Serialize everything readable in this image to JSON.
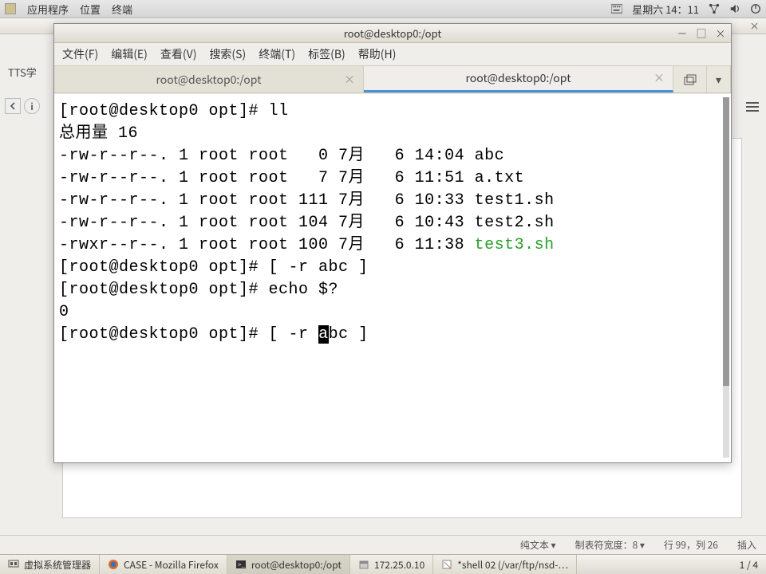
{
  "topbar": {
    "app": "应用程序",
    "places": "位置",
    "terminal_menu": "终端",
    "datetime": "星期六 14：11"
  },
  "gedit": {
    "tab_label": "TTS学",
    "status": {
      "encoding": "纯文本 ▾",
      "tabwidth": "制表符宽度：8 ▾",
      "rowcol": "行 99，列 26",
      "insert": "插入"
    },
    "close": "×"
  },
  "terminal": {
    "title": "root@desktop0:/opt",
    "menus": [
      "文件(F)",
      "编辑(E)",
      "查看(V)",
      "搜索(S)",
      "终端(T)",
      "标签(B)",
      "帮助(H)"
    ],
    "tabs": [
      {
        "label": "root@desktop0:/opt",
        "active": false
      },
      {
        "label": "root@desktop0:/opt",
        "active": true
      }
    ],
    "content": {
      "line1": "[root@desktop0 opt]# ll",
      "line2": "总用量 16",
      "line3": "-rw-r--r--. 1 root root   0 7月   6 14:04 abc",
      "line4": "-rw-r--r--. 1 root root   7 7月   6 11:51 a.txt",
      "line5": "-rw-r--r--. 1 root root 111 7月   6 10:33 test1.sh",
      "line6": "-rw-r--r--. 1 root root 104 7月   6 10:43 test2.sh",
      "line7a": "-rwxr--r--. 1 root root 100 7月   6 11:38 ",
      "line7b": "test3.sh",
      "line8": "[root@desktop0 opt]# [ -r abc ]",
      "line9": "[root@desktop0 opt]# echo $?",
      "line10": "0",
      "line11a": "[root@desktop0 opt]# [ -r ",
      "line11cur": "a",
      "line11b": "bc ]"
    }
  },
  "taskbar": {
    "items": [
      "虚拟系统管理器",
      "CASE - Mozilla Firefox",
      "root@desktop0:/opt",
      "172.25.0.10",
      "*shell 02 (/var/ftp/nsd-…"
    ],
    "pager": "1 / 4"
  }
}
